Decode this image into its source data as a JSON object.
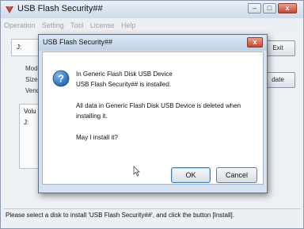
{
  "window": {
    "title": "USB Flash Security##",
    "minimize_glyph": "–",
    "maximize_glyph": "□",
    "close_glyph": "x"
  },
  "menubar": {
    "items": [
      "Operation",
      "Setting",
      "Tool",
      "License",
      "Help"
    ]
  },
  "background": {
    "drive_label": "J:",
    "model_label": "Mode",
    "size_label": "Size:",
    "vendor_label": "Vend",
    "volume_label": "Volu",
    "volume_drive": "J:",
    "exit_button": "Exit",
    "update_button": "date"
  },
  "status": {
    "text": "Please select a disk to install 'USB Flash Security##', and click the button [Install]."
  },
  "dialog": {
    "title": "USB Flash Security##",
    "close_glyph": "x",
    "line1": "In Generic Flash Disk USB Device",
    "line2": " USB Flash Security## is installed.",
    "line3": "All data in Generic Flash Disk USB Device is deleted when",
    "line4": "installing it.",
    "line5": "May I install it?",
    "ok_label": "OK",
    "cancel_label": "Cancel",
    "icon": "question-icon"
  }
}
